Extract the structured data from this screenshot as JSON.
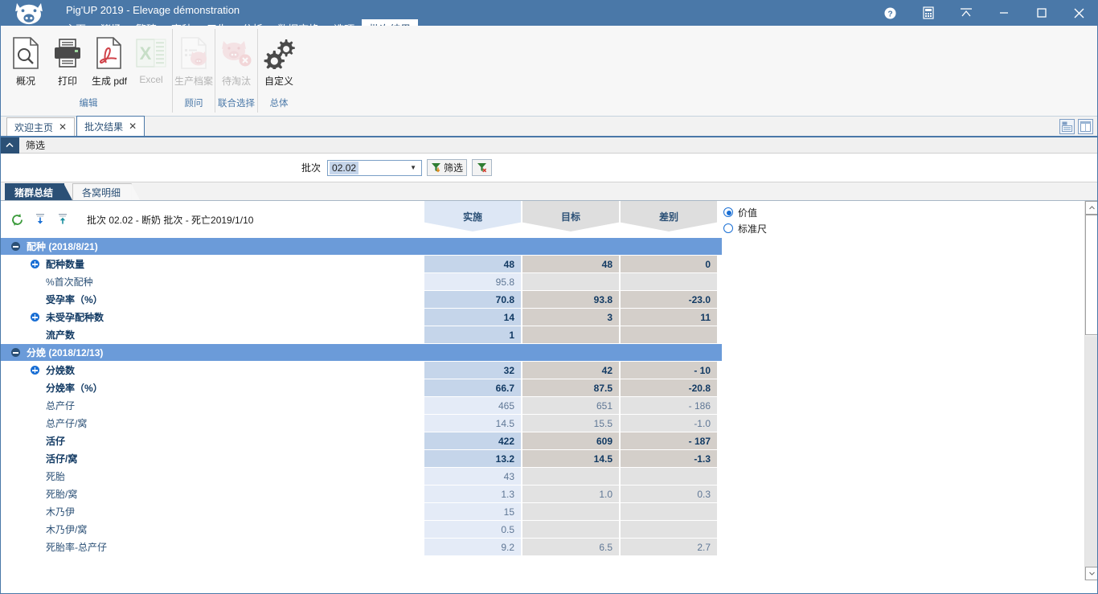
{
  "titlebar": {
    "app_title": "Pig'UP 2019 - Elevage démonstration",
    "logo_name": "pig-head-logo",
    "window_buttons": [
      {
        "name": "help-button",
        "label": "?"
      },
      {
        "name": "calculator-button",
        "label": ""
      },
      {
        "name": "collapse-ribbon-button",
        "label": ""
      },
      {
        "name": "minimize-button",
        "label": ""
      },
      {
        "name": "maximize-button",
        "label": ""
      },
      {
        "name": "close-button",
        "label": ""
      }
    ]
  },
  "menu": {
    "items": [
      {
        "label": "主页",
        "active": false
      },
      {
        "label": "猪场",
        "active": false
      },
      {
        "label": "繁殖",
        "active": false
      },
      {
        "label": "育种",
        "active": false
      },
      {
        "label": "卫生",
        "active": false
      },
      {
        "label": "分析",
        "active": false
      },
      {
        "label": "数据交换",
        "active": false
      },
      {
        "label": "选项",
        "active": false
      },
      {
        "label": "批次结果",
        "active": true
      }
    ]
  },
  "ribbon": {
    "groups": [
      {
        "label": "编辑",
        "buttons": [
          {
            "label": "概况",
            "icon": "document-search-icon",
            "disabled": false
          },
          {
            "label": "打印",
            "icon": "printer-icon",
            "disabled": false
          },
          {
            "label": "生成 pdf",
            "icon": "pdf-icon",
            "disabled": false
          },
          {
            "label": "Excel",
            "icon": "excel-icon",
            "disabled": true
          }
        ]
      },
      {
        "label": "顾问",
        "buttons": [
          {
            "label": "生产档案",
            "icon": "pig-document-icon",
            "disabled": true
          }
        ]
      },
      {
        "label": "联合选择",
        "buttons": [
          {
            "label": "待淘汰",
            "icon": "pig-remove-icon",
            "disabled": true
          }
        ]
      },
      {
        "label": "总体",
        "buttons": [
          {
            "label": "自定义",
            "icon": "gears-icon",
            "disabled": false
          }
        ]
      }
    ]
  },
  "doctabs": {
    "tabs": [
      {
        "label": "欢迎主页",
        "active": false
      },
      {
        "label": "批次结果",
        "active": true
      }
    ],
    "close_icon": "✕",
    "right_buttons": [
      {
        "name": "layout-horizontal-button"
      },
      {
        "name": "layout-vertical-button"
      }
    ]
  },
  "filter": {
    "header_label": "筛选",
    "chevron": "⌃",
    "batch_label": "批次",
    "combo_value": "02.02",
    "combo_placeholder": "",
    "apply_label": "筛选",
    "clear_label": ""
  },
  "subtabs": [
    {
      "label": "猪群总结",
      "active": true
    },
    {
      "label": "各窝明细",
      "active": false
    }
  ],
  "grid": {
    "refresh_icon": "refresh-icon",
    "collapse_all_icon": "collapse-all-icon",
    "expand_all_icon": "expand-all-icon",
    "batch_title": "批次 02.02 -  断奶 批次 - 死亡2019/1/10",
    "columns": [
      {
        "label": "实施",
        "key": "actual"
      },
      {
        "label": "目标",
        "key": "target"
      },
      {
        "label": "差别",
        "key": "diff"
      }
    ],
    "radios": [
      {
        "label": "价值",
        "selected": true
      },
      {
        "label": "标准尺",
        "selected": false
      }
    ],
    "sections": [
      {
        "title": "配种 (2018/8/21)",
        "expanded": true,
        "rows": [
          {
            "label": "配种数量",
            "bold": true,
            "expandable": true,
            "actual": "48",
            "target": "48",
            "diff": "0"
          },
          {
            "label": "%首次配种",
            "bold": false,
            "expandable": false,
            "actual": "95.8",
            "target": "",
            "diff": ""
          },
          {
            "label": "受孕率（%）",
            "bold": true,
            "expandable": false,
            "actual": "70.8",
            "target": "93.8",
            "diff": "-23.0"
          },
          {
            "label": "未受孕配种数",
            "bold": true,
            "expandable": true,
            "actual": "14",
            "target": "3",
            "diff": "11"
          },
          {
            "label": "流产数",
            "bold": true,
            "expandable": false,
            "actual": "1",
            "target": "",
            "diff": ""
          }
        ]
      },
      {
        "title": "分娩 (2018/12/13)",
        "expanded": true,
        "rows": [
          {
            "label": "分娩数",
            "bold": true,
            "expandable": true,
            "actual": "32",
            "target": "42",
            "diff": "- 10"
          },
          {
            "label": "分娩率（%）",
            "bold": true,
            "expandable": false,
            "actual": "66.7",
            "target": "87.5",
            "diff": "-20.8"
          },
          {
            "label": "总产仔",
            "bold": false,
            "expandable": false,
            "actual": "465",
            "target": "651",
            "diff": "- 186"
          },
          {
            "label": "总产仔/窝",
            "bold": false,
            "expandable": false,
            "actual": "14.5",
            "target": "15.5",
            "diff": "-1.0"
          },
          {
            "label": "活仔",
            "bold": true,
            "expandable": false,
            "actual": "422",
            "target": "609",
            "diff": "- 187"
          },
          {
            "label": "活仔/窝",
            "bold": true,
            "expandable": false,
            "actual": "13.2",
            "target": "14.5",
            "diff": "-1.3"
          },
          {
            "label": "死胎",
            "bold": false,
            "expandable": false,
            "actual": "43",
            "target": "",
            "diff": ""
          },
          {
            "label": "死胎/窝",
            "bold": false,
            "expandable": false,
            "actual": "1.3",
            "target": "1.0",
            "diff": "0.3"
          },
          {
            "label": "木乃伊",
            "bold": false,
            "expandable": false,
            "actual": "15",
            "target": "",
            "diff": ""
          },
          {
            "label": "木乃伊/窝",
            "bold": false,
            "expandable": false,
            "actual": "0.5",
            "target": "",
            "diff": ""
          },
          {
            "label": "死胎率-总产仔",
            "bold": false,
            "expandable": false,
            "actual": "9.2",
            "target": "6.5",
            "diff": "2.7"
          }
        ]
      }
    ]
  }
}
